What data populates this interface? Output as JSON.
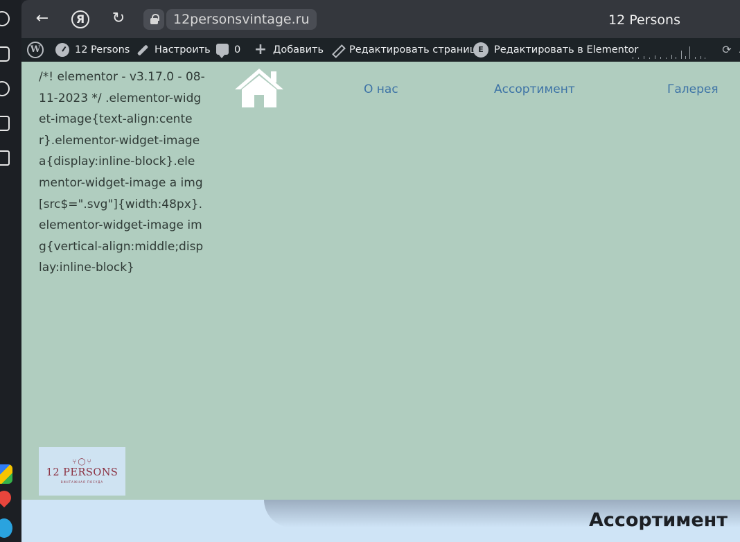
{
  "browser": {
    "url": "12personsvintage.ru",
    "tab_title": "12 Persons",
    "yandex_glyph": "Я"
  },
  "admin_bar": {
    "site_name": "12 Persons",
    "customize": "Настроить",
    "comments_count": "0",
    "add_new": "Добавить",
    "edit_page": "Редактировать страницу",
    "edit_elementor": "Редактировать в Elementor",
    "sync_label": "А",
    "icons": [
      "wordpress-logo-icon",
      "dashboard-icon",
      "brush-icon",
      "comment-icon",
      "plus-icon",
      "pencil-icon",
      "elementor-icon",
      "sync-icon"
    ]
  },
  "page": {
    "css_text": "/*! elementor - v3.17.0 - 08-11-2023 */ .elementor-widget-image{text-align:center}.elementor-widget-image a{display:inline-block}.elementor-widget-image a img[src$=\".svg\"]{width:48px}.elementor-widget-image img{vertical-align:middle;display:inline-block}",
    "nav": {
      "about": "О нас",
      "assortment": "Ассортимент",
      "gallery": "Галерея"
    },
    "brand_logo": {
      "name": "12 PERSONS",
      "subtitle": "ВИНТАЖНАЯ ПОСУДА"
    },
    "section_title": "Ассортимент"
  },
  "colors": {
    "page_bg": "#b0cdbf",
    "lower_bg": "#cfe4f6",
    "link": "#3d73a6",
    "admin_bar": "#1d2327",
    "logo_text": "#8a2d3e"
  }
}
